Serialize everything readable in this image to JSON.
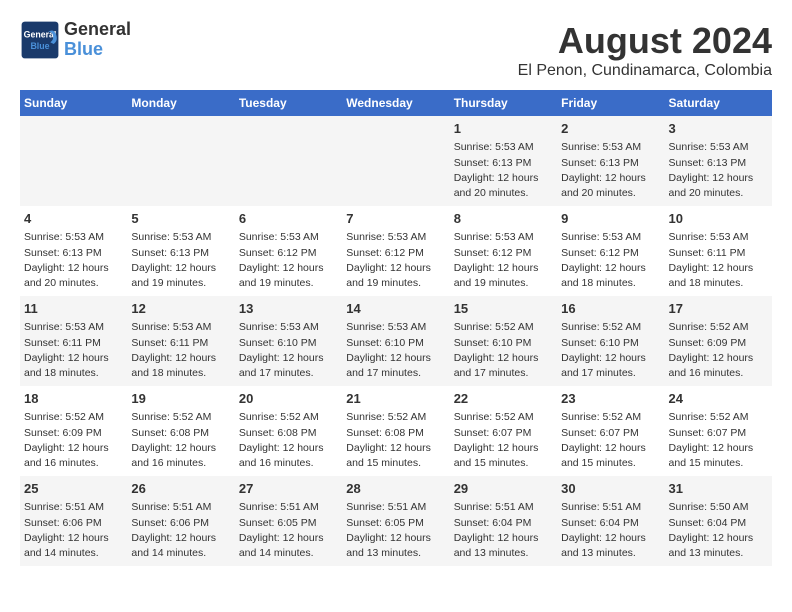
{
  "header": {
    "logo_line1": "General",
    "logo_line2": "Blue",
    "title": "August 2024",
    "subtitle": "El Penon, Cundinamarca, Colombia"
  },
  "weekdays": [
    "Sunday",
    "Monday",
    "Tuesday",
    "Wednesday",
    "Thursday",
    "Friday",
    "Saturday"
  ],
  "weeks": [
    [
      {
        "day": "",
        "info": ""
      },
      {
        "day": "",
        "info": ""
      },
      {
        "day": "",
        "info": ""
      },
      {
        "day": "",
        "info": ""
      },
      {
        "day": "1",
        "info": "Sunrise: 5:53 AM\nSunset: 6:13 PM\nDaylight: 12 hours\nand 20 minutes."
      },
      {
        "day": "2",
        "info": "Sunrise: 5:53 AM\nSunset: 6:13 PM\nDaylight: 12 hours\nand 20 minutes."
      },
      {
        "day": "3",
        "info": "Sunrise: 5:53 AM\nSunset: 6:13 PM\nDaylight: 12 hours\nand 20 minutes."
      }
    ],
    [
      {
        "day": "4",
        "info": "Sunrise: 5:53 AM\nSunset: 6:13 PM\nDaylight: 12 hours\nand 20 minutes."
      },
      {
        "day": "5",
        "info": "Sunrise: 5:53 AM\nSunset: 6:13 PM\nDaylight: 12 hours\nand 19 minutes."
      },
      {
        "day": "6",
        "info": "Sunrise: 5:53 AM\nSunset: 6:12 PM\nDaylight: 12 hours\nand 19 minutes."
      },
      {
        "day": "7",
        "info": "Sunrise: 5:53 AM\nSunset: 6:12 PM\nDaylight: 12 hours\nand 19 minutes."
      },
      {
        "day": "8",
        "info": "Sunrise: 5:53 AM\nSunset: 6:12 PM\nDaylight: 12 hours\nand 19 minutes."
      },
      {
        "day": "9",
        "info": "Sunrise: 5:53 AM\nSunset: 6:12 PM\nDaylight: 12 hours\nand 18 minutes."
      },
      {
        "day": "10",
        "info": "Sunrise: 5:53 AM\nSunset: 6:11 PM\nDaylight: 12 hours\nand 18 minutes."
      }
    ],
    [
      {
        "day": "11",
        "info": "Sunrise: 5:53 AM\nSunset: 6:11 PM\nDaylight: 12 hours\nand 18 minutes."
      },
      {
        "day": "12",
        "info": "Sunrise: 5:53 AM\nSunset: 6:11 PM\nDaylight: 12 hours\nand 18 minutes."
      },
      {
        "day": "13",
        "info": "Sunrise: 5:53 AM\nSunset: 6:10 PM\nDaylight: 12 hours\nand 17 minutes."
      },
      {
        "day": "14",
        "info": "Sunrise: 5:53 AM\nSunset: 6:10 PM\nDaylight: 12 hours\nand 17 minutes."
      },
      {
        "day": "15",
        "info": "Sunrise: 5:52 AM\nSunset: 6:10 PM\nDaylight: 12 hours\nand 17 minutes."
      },
      {
        "day": "16",
        "info": "Sunrise: 5:52 AM\nSunset: 6:10 PM\nDaylight: 12 hours\nand 17 minutes."
      },
      {
        "day": "17",
        "info": "Sunrise: 5:52 AM\nSunset: 6:09 PM\nDaylight: 12 hours\nand 16 minutes."
      }
    ],
    [
      {
        "day": "18",
        "info": "Sunrise: 5:52 AM\nSunset: 6:09 PM\nDaylight: 12 hours\nand 16 minutes."
      },
      {
        "day": "19",
        "info": "Sunrise: 5:52 AM\nSunset: 6:08 PM\nDaylight: 12 hours\nand 16 minutes."
      },
      {
        "day": "20",
        "info": "Sunrise: 5:52 AM\nSunset: 6:08 PM\nDaylight: 12 hours\nand 16 minutes."
      },
      {
        "day": "21",
        "info": "Sunrise: 5:52 AM\nSunset: 6:08 PM\nDaylight: 12 hours\nand 15 minutes."
      },
      {
        "day": "22",
        "info": "Sunrise: 5:52 AM\nSunset: 6:07 PM\nDaylight: 12 hours\nand 15 minutes."
      },
      {
        "day": "23",
        "info": "Sunrise: 5:52 AM\nSunset: 6:07 PM\nDaylight: 12 hours\nand 15 minutes."
      },
      {
        "day": "24",
        "info": "Sunrise: 5:52 AM\nSunset: 6:07 PM\nDaylight: 12 hours\nand 15 minutes."
      }
    ],
    [
      {
        "day": "25",
        "info": "Sunrise: 5:51 AM\nSunset: 6:06 PM\nDaylight: 12 hours\nand 14 minutes."
      },
      {
        "day": "26",
        "info": "Sunrise: 5:51 AM\nSunset: 6:06 PM\nDaylight: 12 hours\nand 14 minutes."
      },
      {
        "day": "27",
        "info": "Sunrise: 5:51 AM\nSunset: 6:05 PM\nDaylight: 12 hours\nand 14 minutes."
      },
      {
        "day": "28",
        "info": "Sunrise: 5:51 AM\nSunset: 6:05 PM\nDaylight: 12 hours\nand 13 minutes."
      },
      {
        "day": "29",
        "info": "Sunrise: 5:51 AM\nSunset: 6:04 PM\nDaylight: 12 hours\nand 13 minutes."
      },
      {
        "day": "30",
        "info": "Sunrise: 5:51 AM\nSunset: 6:04 PM\nDaylight: 12 hours\nand 13 minutes."
      },
      {
        "day": "31",
        "info": "Sunrise: 5:50 AM\nSunset: 6:04 PM\nDaylight: 12 hours\nand 13 minutes."
      }
    ]
  ]
}
